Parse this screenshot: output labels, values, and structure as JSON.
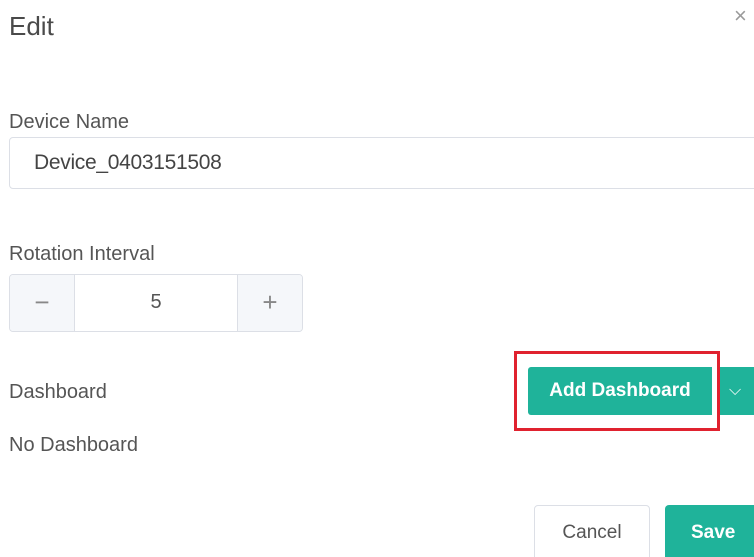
{
  "dialog": {
    "title": "Edit",
    "close_icon": "close-icon",
    "close_glyph": "×"
  },
  "device_name": {
    "label": "Device Name",
    "value": "Device_0403151508"
  },
  "rotation_interval": {
    "label": "Rotation Interval",
    "decrement_glyph": "−",
    "increment_glyph": "+",
    "value": "5"
  },
  "dashboard": {
    "label": "Dashboard",
    "empty_text": "No Dashboard",
    "add_button_label": "Add Dashboard",
    "dropdown_icon": "chevron-down-icon",
    "dropdown_glyph": "⌵"
  },
  "footer": {
    "cancel_label": "Cancel",
    "save_label": "Save"
  },
  "colors": {
    "accent": "#1fb39a",
    "highlight": "#e0222f"
  }
}
